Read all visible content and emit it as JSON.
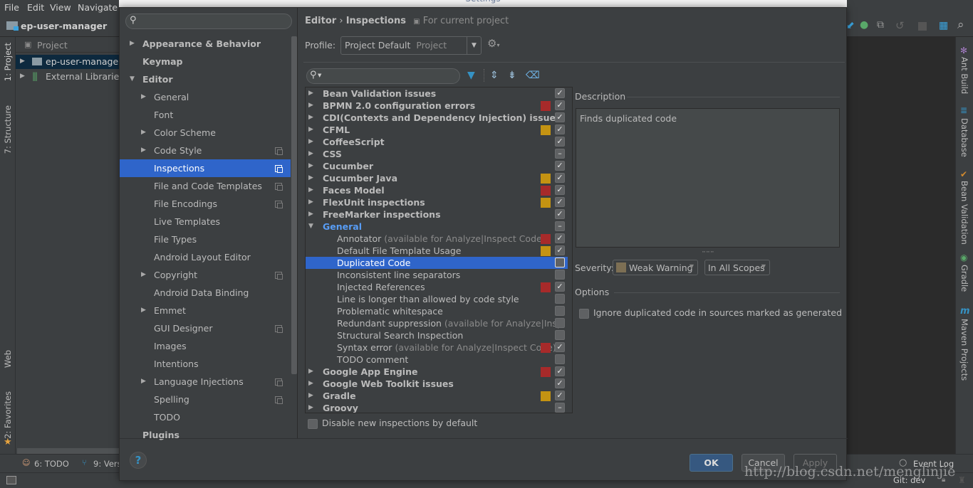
{
  "menubar": {
    "items": [
      "File",
      "Edit",
      "View",
      "Navigate"
    ]
  },
  "navbar": {
    "project_name": "ep-user-manager"
  },
  "project_panel": {
    "header": "Project",
    "items": [
      {
        "label": "ep-user-manager",
        "icon": "folder-module-icon",
        "selected": true
      },
      {
        "label": "External Libraries",
        "icon": "libraries-icon",
        "selected": false
      }
    ]
  },
  "left_tool_strip": {
    "items": [
      "1: Project",
      "7: Structure",
      "Web",
      "2: Favorites"
    ]
  },
  "right_tool_strip": {
    "items": [
      "Ant Build",
      "Database",
      "Bean Validation",
      "Gradle",
      "Maven Projects"
    ]
  },
  "bottom_tools": {
    "items": [
      "6: TODO",
      "9: Vers"
    ],
    "event_log": "Event Log"
  },
  "statusbar": {
    "git_branch": "Git: dev"
  },
  "dialog": {
    "title": "Settings",
    "sidebar": {
      "search_placeholder": "",
      "items": [
        {
          "label": "Appearance & Behavior",
          "level": 0,
          "bold": true,
          "expandable": true,
          "expanded": false,
          "project_scope": false
        },
        {
          "label": "Keymap",
          "level": 0,
          "bold": true,
          "expandable": false,
          "project_scope": false
        },
        {
          "label": "Editor",
          "level": 0,
          "bold": true,
          "expandable": true,
          "expanded": true,
          "project_scope": false
        },
        {
          "label": "General",
          "level": 1,
          "expandable": true,
          "expanded": false,
          "project_scope": false
        },
        {
          "label": "Font",
          "level": 1,
          "expandable": false,
          "project_scope": false
        },
        {
          "label": "Color Scheme",
          "level": 1,
          "expandable": true,
          "expanded": false,
          "project_scope": false
        },
        {
          "label": "Code Style",
          "level": 1,
          "expandable": true,
          "expanded": false,
          "project_scope": true
        },
        {
          "label": "Inspections",
          "level": 1,
          "expandable": false,
          "project_scope": true,
          "selected": true
        },
        {
          "label": "File and Code Templates",
          "level": 1,
          "expandable": false,
          "project_scope": true
        },
        {
          "label": "File Encodings",
          "level": 1,
          "expandable": false,
          "project_scope": true
        },
        {
          "label": "Live Templates",
          "level": 1,
          "expandable": false,
          "project_scope": false
        },
        {
          "label": "File Types",
          "level": 1,
          "expandable": false,
          "project_scope": false
        },
        {
          "label": "Android Layout Editor",
          "level": 1,
          "expandable": false,
          "project_scope": false
        },
        {
          "label": "Copyright",
          "level": 1,
          "expandable": true,
          "expanded": false,
          "project_scope": true
        },
        {
          "label": "Android Data Binding",
          "level": 1,
          "expandable": false,
          "project_scope": false
        },
        {
          "label": "Emmet",
          "level": 1,
          "expandable": true,
          "expanded": false,
          "project_scope": false
        },
        {
          "label": "GUI Designer",
          "level": 1,
          "expandable": false,
          "project_scope": true
        },
        {
          "label": "Images",
          "level": 1,
          "expandable": false,
          "project_scope": false
        },
        {
          "label": "Intentions",
          "level": 1,
          "expandable": false,
          "project_scope": false
        },
        {
          "label": "Language Injections",
          "level": 1,
          "expandable": true,
          "expanded": false,
          "project_scope": true
        },
        {
          "label": "Spelling",
          "level": 1,
          "expandable": false,
          "project_scope": true
        },
        {
          "label": "TODO",
          "level": 1,
          "expandable": false,
          "project_scope": false
        },
        {
          "label": "Plugins",
          "level": 0,
          "bold": true,
          "expandable": false,
          "project_scope": false
        }
      ]
    },
    "breadcrumb": {
      "parent": "Editor",
      "separator": "›",
      "current": "Inspections",
      "scope_note": "For current project"
    },
    "profile": {
      "label": "Profile:",
      "value": "Project Default",
      "value_scope": "Project"
    },
    "inspections_search_placeholder": "",
    "inspections": [
      {
        "label": "Bean Validation issues",
        "type": "group",
        "severity": null,
        "state": "checked"
      },
      {
        "label": "BPMN 2.0 configuration errors",
        "type": "group",
        "severity": "error",
        "state": "checked"
      },
      {
        "label": "CDI(Contexts and Dependency Injection) issues",
        "type": "group",
        "severity": null,
        "state": "checked"
      },
      {
        "label": "CFML",
        "type": "group",
        "severity": "warning",
        "state": "checked"
      },
      {
        "label": "CoffeeScript",
        "type": "group",
        "severity": null,
        "state": "checked"
      },
      {
        "label": "CSS",
        "type": "group",
        "severity": null,
        "state": "mixed"
      },
      {
        "label": "Cucumber",
        "type": "group",
        "severity": null,
        "state": "checked"
      },
      {
        "label": "Cucumber Java",
        "type": "group",
        "severity": "warning",
        "state": "checked"
      },
      {
        "label": "Faces Model",
        "type": "group",
        "severity": "error",
        "state": "checked"
      },
      {
        "label": "FlexUnit inspections",
        "type": "group",
        "severity": "warning",
        "state": "checked"
      },
      {
        "label": "FreeMarker inspections",
        "type": "group",
        "severity": null,
        "state": "checked"
      },
      {
        "label": "General",
        "type": "group",
        "expanded": true,
        "highlight": true,
        "severity": null,
        "state": "mixed"
      },
      {
        "label": "Annotator",
        "hint": "(available for Analyze|Inspect Code)",
        "type": "child",
        "severity": "error",
        "state": "checked"
      },
      {
        "label": "Default File Template Usage",
        "type": "child",
        "severity": "warning",
        "state": "checked"
      },
      {
        "label": "Duplicated Code",
        "type": "child",
        "severity": null,
        "state": "unchecked",
        "selected": true
      },
      {
        "label": "Inconsistent line separators",
        "type": "child",
        "severity": null,
        "state": "unchecked"
      },
      {
        "label": "Injected References",
        "type": "child",
        "severity": "error",
        "state": "checked"
      },
      {
        "label": "Line is longer than allowed by code style",
        "type": "child",
        "severity": null,
        "state": "unchecked"
      },
      {
        "label": "Problematic whitespace",
        "type": "child",
        "severity": null,
        "state": "unchecked"
      },
      {
        "label": "Redundant suppression",
        "hint": "(available for Analyze|Insp",
        "type": "child",
        "severity": null,
        "state": "unchecked"
      },
      {
        "label": "Structural Search Inspection",
        "type": "child",
        "severity": null,
        "state": "unchecked"
      },
      {
        "label": "Syntax error",
        "hint": "(available for Analyze|Inspect Code)",
        "type": "child",
        "severity": "error",
        "state": "checked"
      },
      {
        "label": "TODO comment",
        "type": "child",
        "severity": null,
        "state": "unchecked"
      },
      {
        "label": "Google App Engine",
        "type": "group",
        "severity": "error",
        "state": "checked"
      },
      {
        "label": "Google Web Toolkit issues",
        "type": "group",
        "severity": null,
        "state": "checked"
      },
      {
        "label": "Gradle",
        "type": "group",
        "severity": "warning",
        "state": "checked"
      },
      {
        "label": "Groovy",
        "type": "group",
        "severity": null,
        "state": "mixed"
      }
    ],
    "disable_new_label": "Disable new inspections by default",
    "description": {
      "title": "Description",
      "text": "Finds duplicated code"
    },
    "severity": {
      "label": "Severity:",
      "value": "Weak Warning",
      "scope": "In All Scopes"
    },
    "options": {
      "title": "Options",
      "ignore_generated_label": "Ignore duplicated code in sources marked as generated"
    },
    "buttons": {
      "help": "?",
      "ok": "OK",
      "cancel": "Cancel",
      "apply": "Apply"
    }
  },
  "colors": {
    "selection": "#2f65ca",
    "error": "#a72a2a",
    "warning": "#c49312",
    "weak_warning": "#7d6f54",
    "highlight_group": "#589df6"
  },
  "watermark": "http://blog.csdn.net/menglinjie"
}
